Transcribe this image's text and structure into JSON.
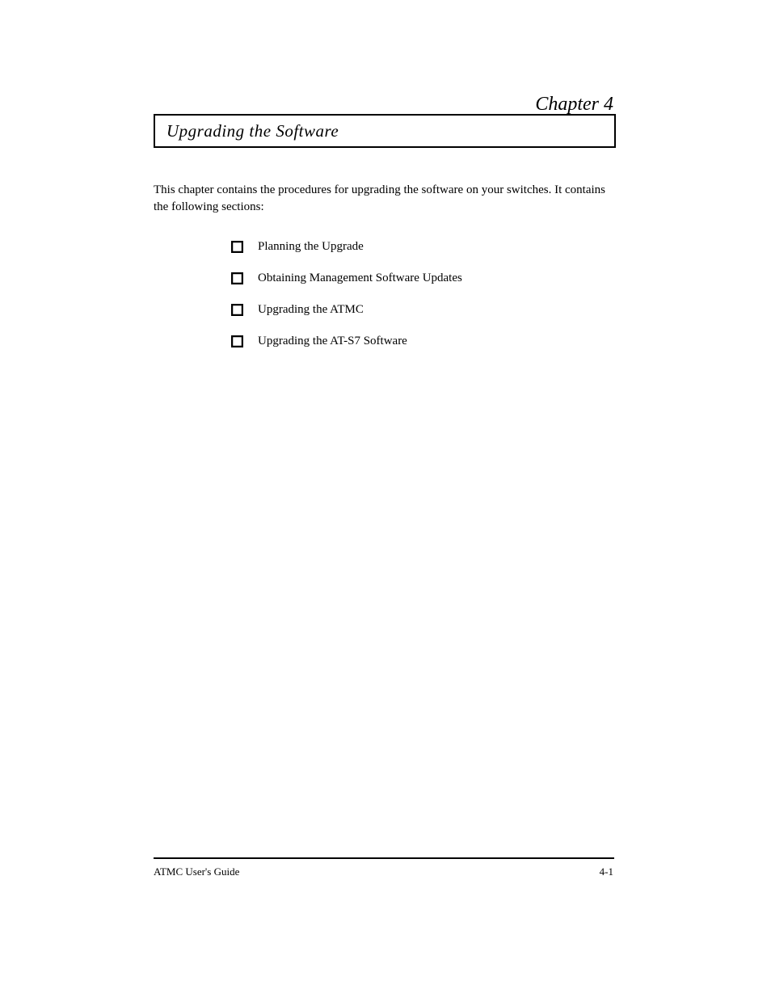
{
  "chapter": "Chapter 4",
  "title": "Upgrading the Software",
  "intro": "This chapter contains the procedures for upgrading the software on your switches. It contains the following sections:",
  "bullets": [
    "Planning the Upgrade",
    "Obtaining Management Software Updates",
    "Upgrading the ATMC",
    "Upgrading the AT-S7 Software"
  ],
  "footer_left": "ATMC User's Guide",
  "footer_right": "4-1"
}
